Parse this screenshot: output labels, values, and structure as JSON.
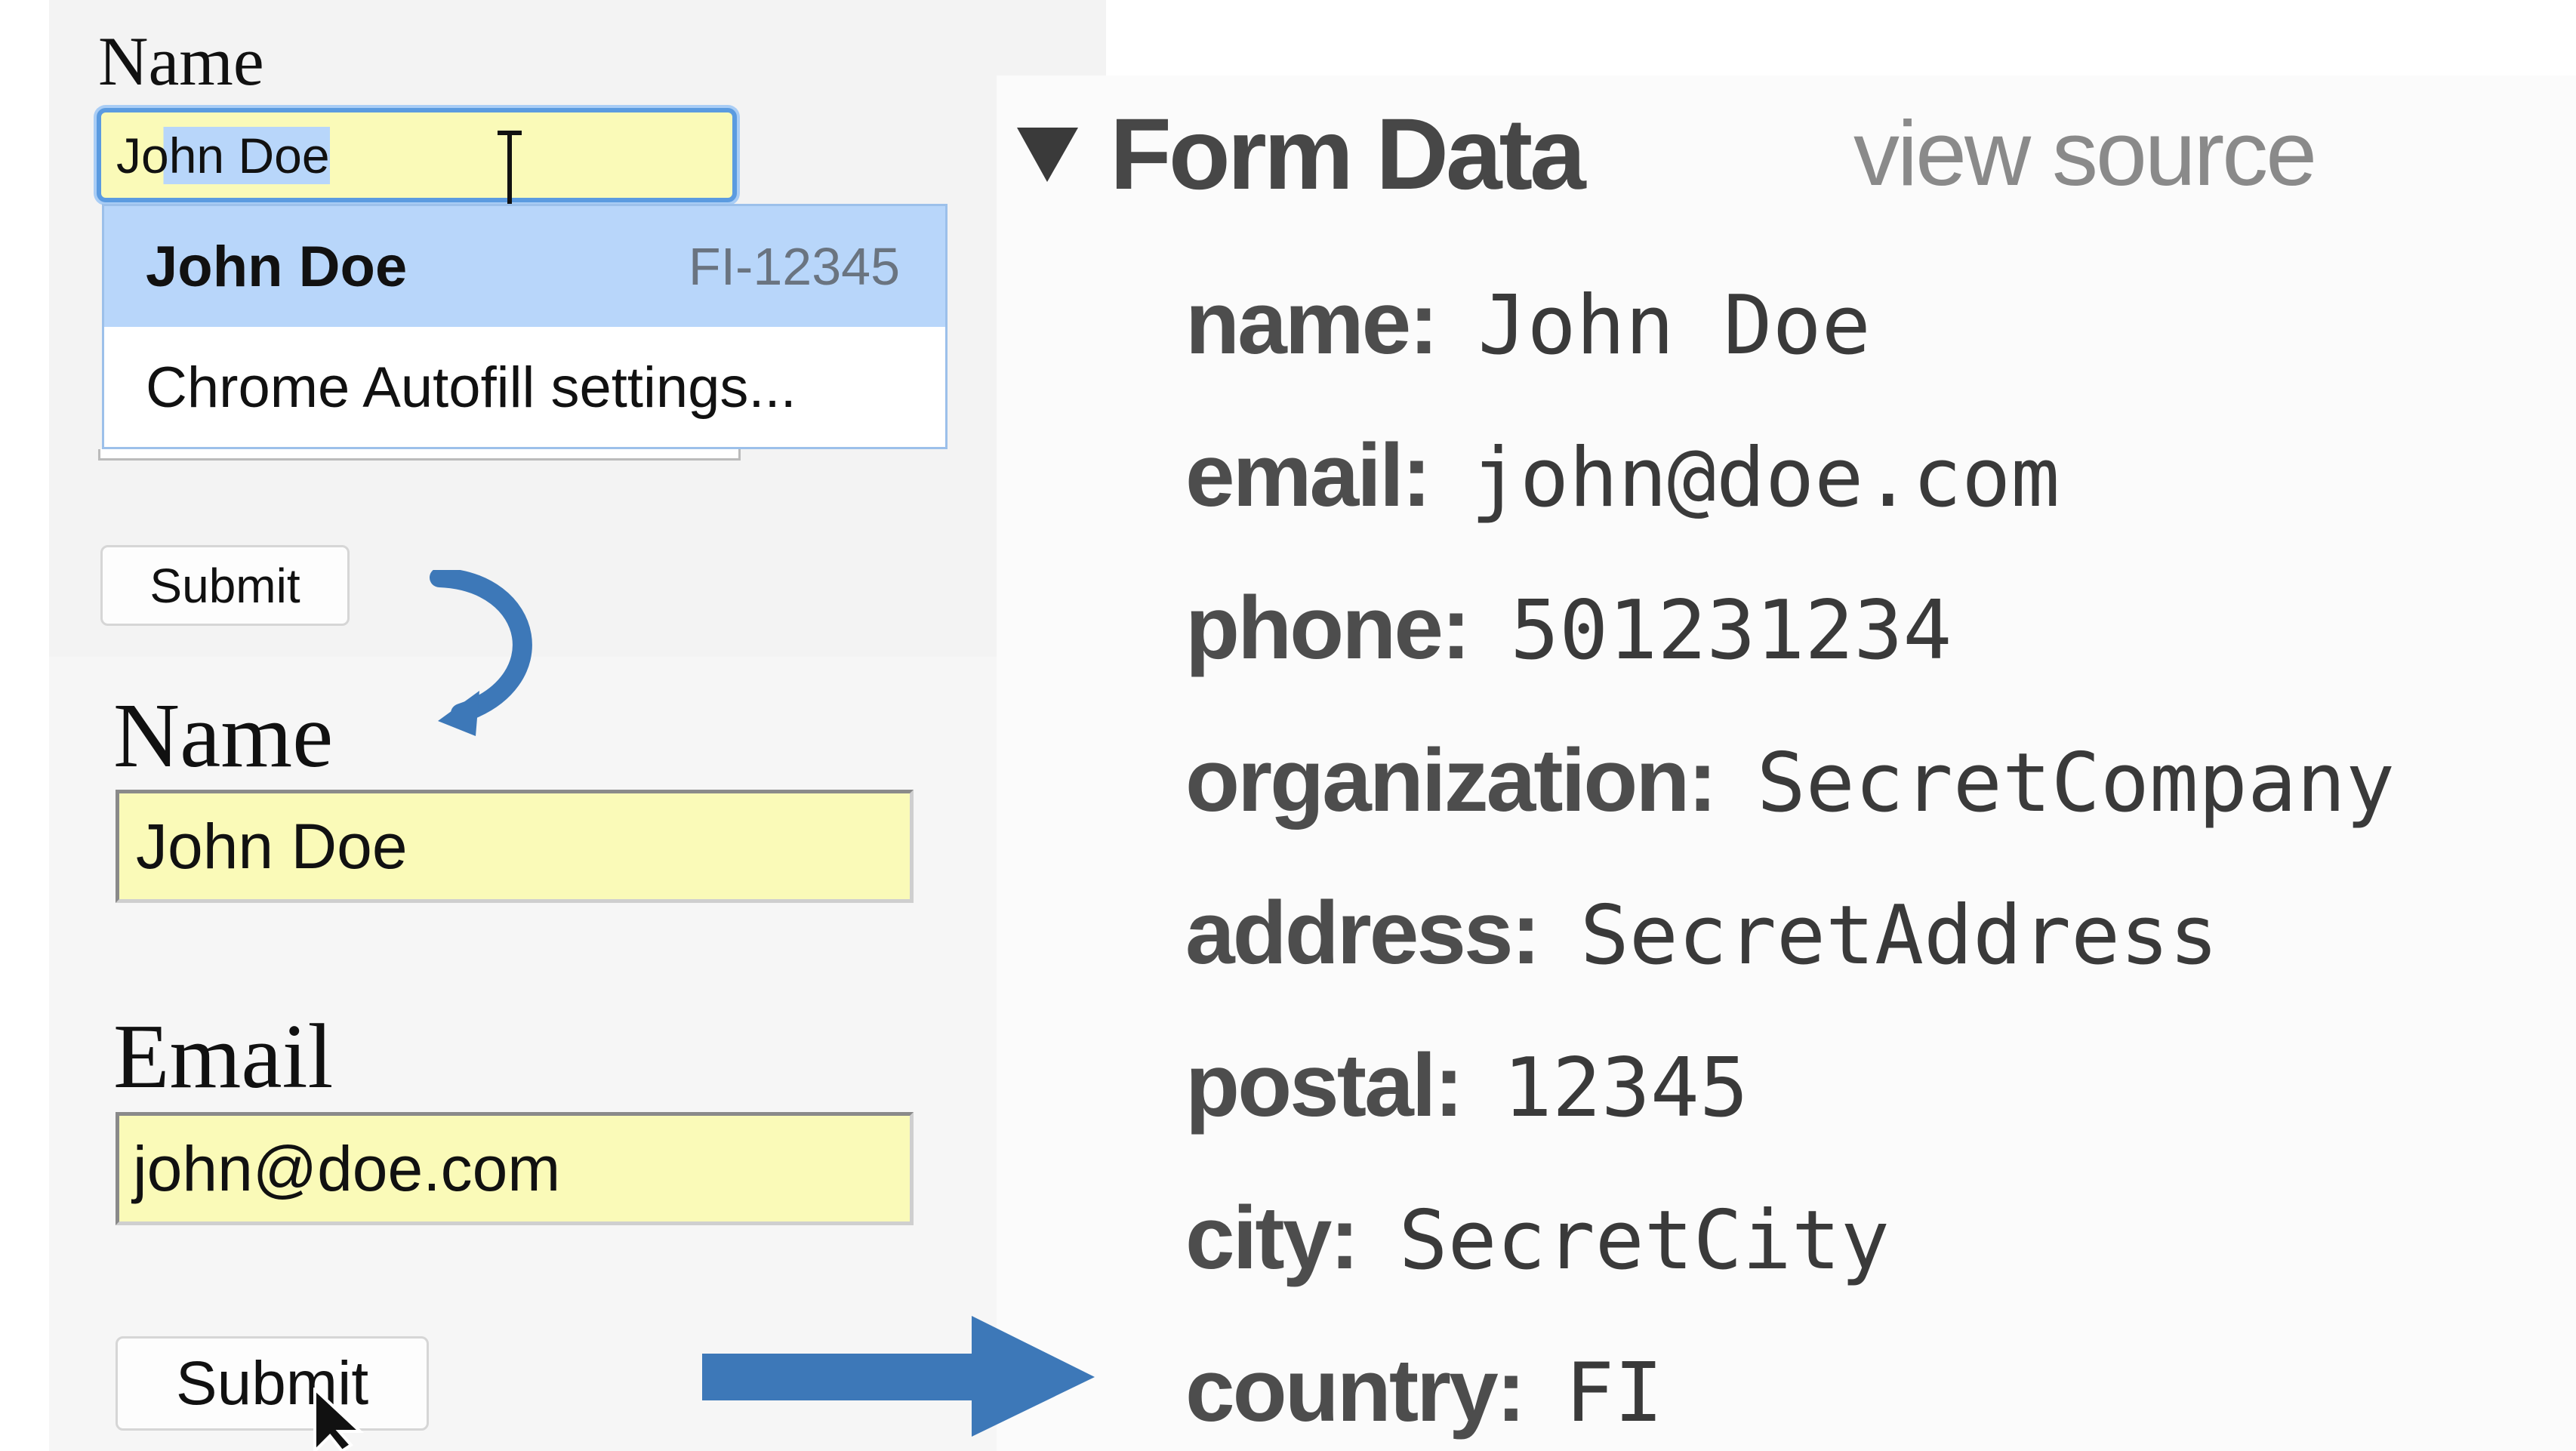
{
  "form_top": {
    "name_label": "Name",
    "name_input_value": "John Doe",
    "autofill": {
      "suggestion_name": "John Doe",
      "suggestion_detail": "FI-12345",
      "settings_label": "Chrome Autofill settings..."
    },
    "submit_label": "Submit"
  },
  "form_filled": {
    "name_label": "Name",
    "name_value": "John Doe",
    "email_label": "Email",
    "email_value": "john@doe.com",
    "submit_label": "Submit"
  },
  "form_data": {
    "title": "Form Data",
    "view_source_label": "view source",
    "rows": [
      {
        "key": "name:",
        "value": "John Doe"
      },
      {
        "key": "email:",
        "value": "john@doe.com"
      },
      {
        "key": "phone:",
        "value": "501231234"
      },
      {
        "key": "organization:",
        "value": "SecretCompany"
      },
      {
        "key": "address:",
        "value": "SecretAddress"
      },
      {
        "key": "postal:",
        "value": "12345"
      },
      {
        "key": "city:",
        "value": "SecretCity"
      },
      {
        "key": "country:",
        "value": "FI"
      }
    ]
  },
  "colors": {
    "autofill_yellow": "#fafab8",
    "selection_blue": "#b8d6fa",
    "arrow_blue": "#3d78b8"
  }
}
